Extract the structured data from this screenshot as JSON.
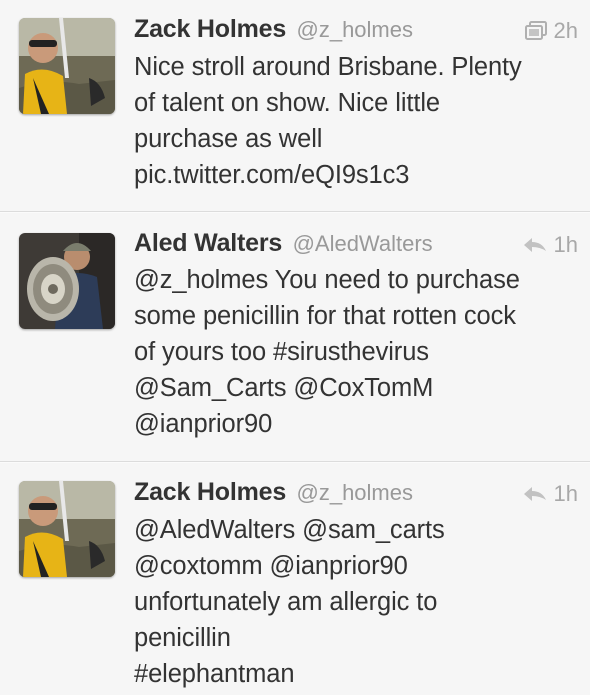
{
  "tweets": [
    {
      "name": "Zack Holmes",
      "handle": "@z_holmes",
      "time": "2h",
      "action_icon": "media-gallery-icon",
      "lines": [
        "Nice stroll around Brisbane. Plenty",
        "of talent on show. Nice little",
        "purchase as well",
        "pic.twitter.com/eQI9s1c3"
      ]
    },
    {
      "name": "Aled Walters",
      "handle": "@AledWalters",
      "time": "1h",
      "action_icon": "reply-arrow-icon",
      "lines": [
        "@z_holmes You need to purchase",
        "some penicillin for that rotten cock",
        "of yours too #sirusthevirus",
        "@Sam_Carts @CoxTomM",
        "@ianprior90"
      ]
    },
    {
      "name": "Zack Holmes",
      "handle": "@z_holmes",
      "time": "1h",
      "action_icon": "reply-arrow-icon",
      "lines": [
        "@AledWalters @sam_carts",
        "@coxtomm @ianprior90",
        "unfortunately am allergic to",
        "penicillin",
        "#elephantman"
      ]
    }
  ],
  "colors": {
    "background": "#f6f6f6",
    "name": "#333333",
    "handle": "#999999",
    "meta": "#a8a8a8",
    "divider": "#dcdcdc"
  }
}
